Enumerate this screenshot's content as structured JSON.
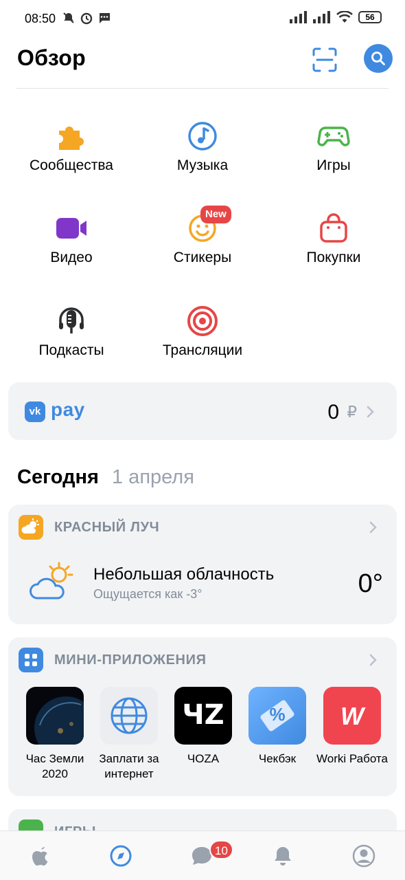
{
  "status_bar": {
    "time": "08:50",
    "battery": "56"
  },
  "header": {
    "title": "Обзор"
  },
  "services": [
    {
      "label": "Сообщества",
      "icon": "puzzle-icon"
    },
    {
      "label": "Музыка",
      "icon": "music-icon"
    },
    {
      "label": "Игры",
      "icon": "gamepad-icon"
    },
    {
      "label": "Видео",
      "icon": "video-icon"
    },
    {
      "label": "Стикеры",
      "icon": "smile-icon",
      "badge": "New"
    },
    {
      "label": "Покупки",
      "icon": "shopping-bag-icon"
    },
    {
      "label": "Подкасты",
      "icon": "podcast-icon"
    },
    {
      "label": "Трансляции",
      "icon": "broadcast-icon"
    }
  ],
  "vk_pay": {
    "logo": "vk",
    "label": "pay",
    "balance": "0",
    "currency": "₽"
  },
  "today": {
    "title": "Сегодня",
    "date": "1 апреля"
  },
  "weather": {
    "city": "КРАСНЫЙ ЛУЧ",
    "condition": "Небольшая облачность",
    "feels_like": "Ощущается как -3°",
    "temperature": "0°"
  },
  "mini_apps": {
    "title": "МИНИ-ПРИЛОЖЕНИЯ",
    "items": [
      {
        "label": "Час Земли 2020"
      },
      {
        "label": "Заплати за интернет"
      },
      {
        "label": "ЧOZA",
        "logo_text": "ЧZ"
      },
      {
        "label": "Чекбэк",
        "logo_text": "%"
      },
      {
        "label": "Worki Работа",
        "logo_text": "W"
      }
    ]
  },
  "games_section": {
    "title": "ИГРЫ"
  },
  "tab_bar": {
    "messages_count": "10"
  },
  "colors": {
    "accent": "#3f8ae0",
    "badge": "#e64646",
    "secondary_text": "#818c99"
  }
}
